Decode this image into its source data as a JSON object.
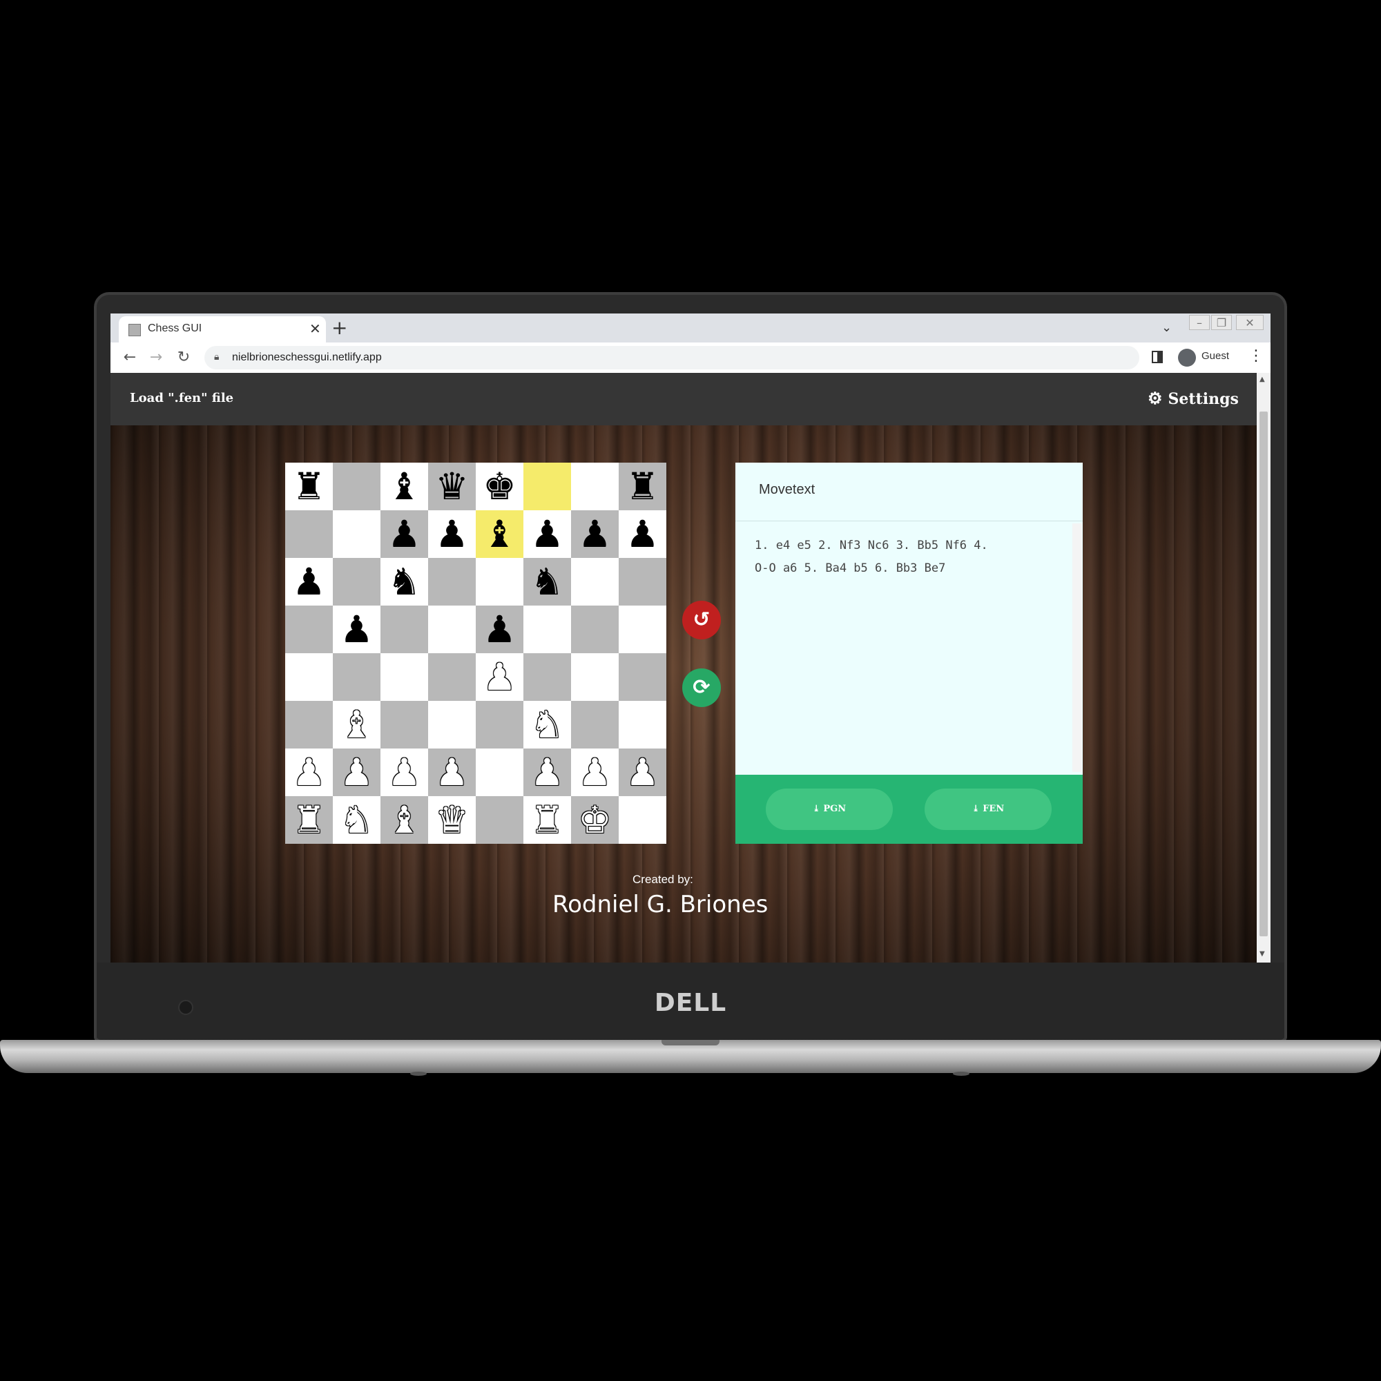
{
  "device": {
    "brand": "DELL"
  },
  "browser": {
    "tab_title": "Chess GUI",
    "tab_close": "✕",
    "new_tab": "+",
    "url": "nielbrioneschessgui.netlify.app",
    "profile_label": "Guest"
  },
  "header": {
    "load_label": "Load \".fen\" file",
    "settings_label": "Settings"
  },
  "board": {
    "highlight_squares": [
      "f8",
      "e7"
    ],
    "ranks": [
      [
        "br",
        "",
        "bb",
        "bq",
        "bk",
        "",
        "",
        "br"
      ],
      [
        "",
        "",
        "bp",
        "bp",
        "bb",
        "bp",
        "bp",
        "bp"
      ],
      [
        "bp",
        "",
        "bn",
        "",
        "",
        "bn",
        "",
        ""
      ],
      [
        "",
        "bp",
        "",
        "",
        "bp",
        "",
        "",
        ""
      ],
      [
        "",
        "",
        "",
        "",
        "wp",
        "",
        "",
        ""
      ],
      [
        "",
        "wb",
        "",
        "",
        "",
        "wn",
        "",
        ""
      ],
      [
        "wp",
        "wp",
        "wp",
        "wp",
        "",
        "wp",
        "wp",
        "wp"
      ],
      [
        "wr",
        "wn",
        "wb",
        "wq",
        "",
        "wr",
        "wk",
        ""
      ]
    ]
  },
  "panel": {
    "title": "Movetext",
    "movetext": "1. e4 e5 2. Nf3 Nc6 3. Bb5 Nf6 4.\nO-O a6 5. Ba4 b5 6. Bb3 Be7",
    "pgn_label": "PGN",
    "fen_label": "FEN"
  },
  "footer": {
    "created_by": "Created by:",
    "author": "Rodniel G. Briones"
  },
  "colors": {
    "undo": "#c0201f",
    "flip": "#27a865",
    "panel_footer": "#26b573",
    "highlight": "#f5eb6b"
  }
}
